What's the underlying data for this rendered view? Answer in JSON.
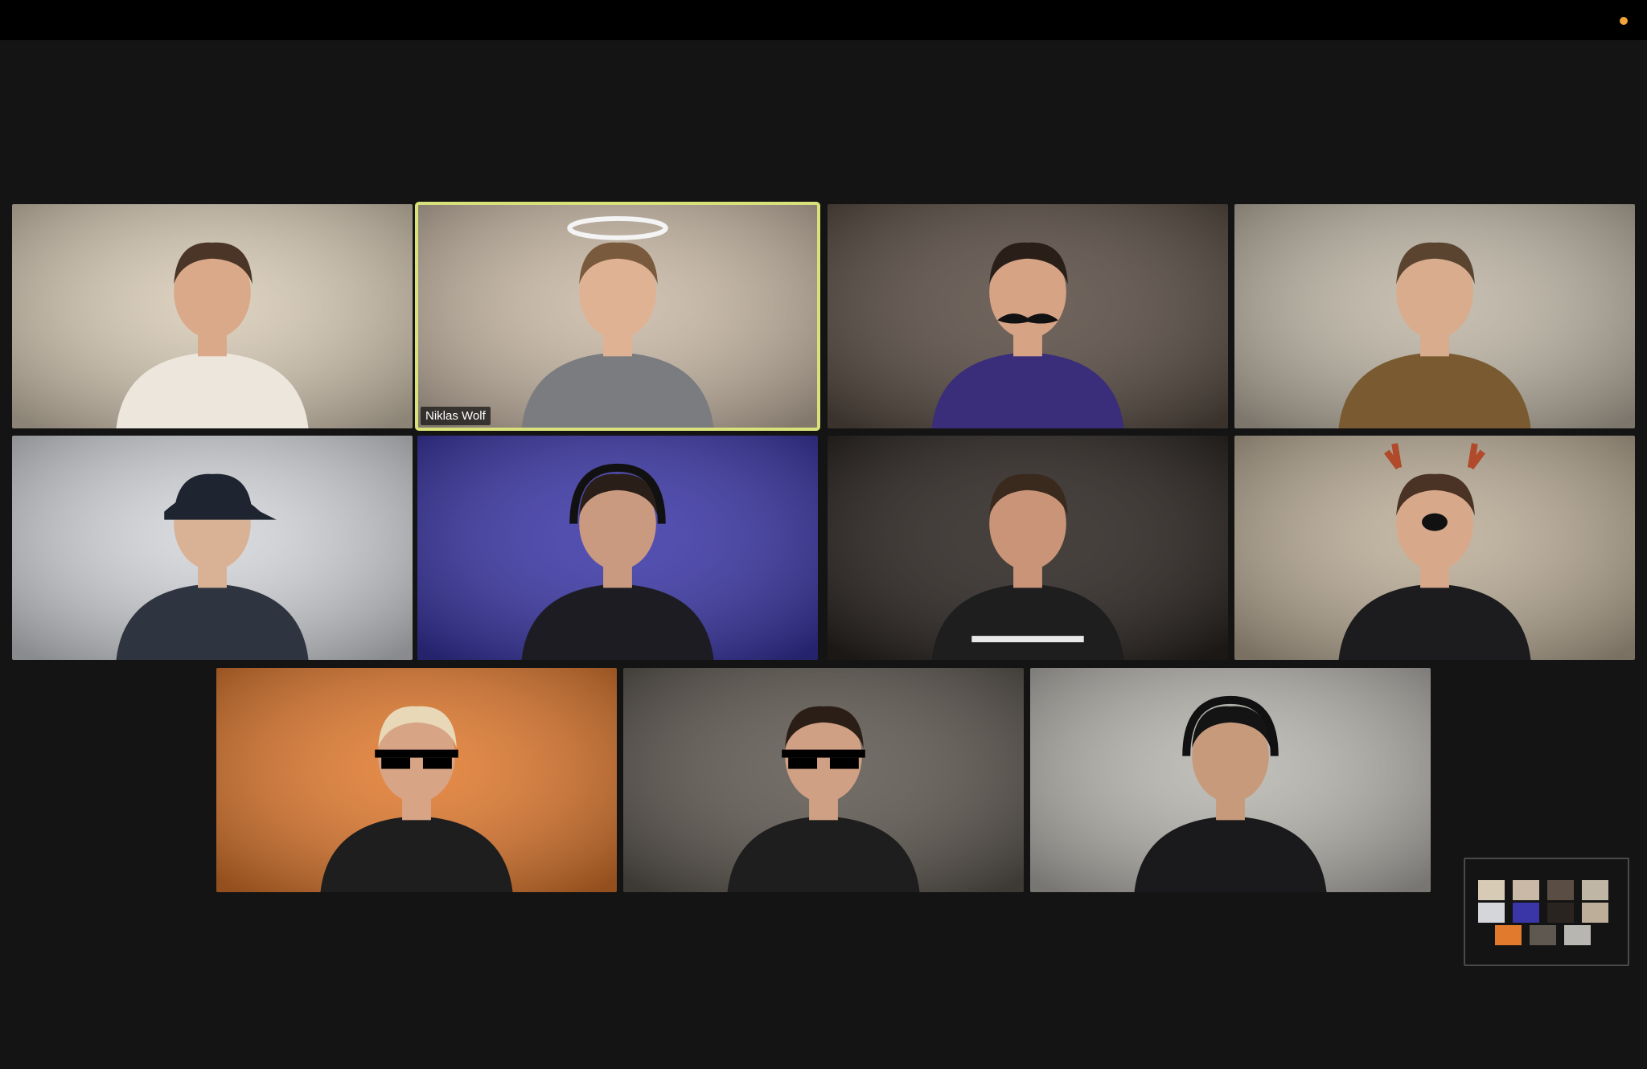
{
  "meeting": {
    "recording_indicator_color": "#f3a33b"
  },
  "participants": [
    {
      "label": "",
      "bg": "#d8cbb6",
      "skin": "#d9a98a",
      "shirt": "#ece6dc",
      "hair": "#4a3526",
      "accessory": "none"
    },
    {
      "label": "Niklas Wolf",
      "bg": "#c9b9a6",
      "skin": "#e0b294",
      "shirt": "#7a7c80",
      "hair": "#7a5a3c",
      "accessory": "halo",
      "active_speaker": true,
      "highlight_color": "#d9e27a"
    },
    {
      "label": "",
      "bg": "#5a4d44",
      "skin": "#d6a385",
      "shirt": "#3a2d7a",
      "hair": "#2a1e18",
      "accessory": "mustache"
    },
    {
      "label": "",
      "bg": "#bfb6a6",
      "skin": "#d8ac8c",
      "shirt": "#7a5a30",
      "hair": "#5a4430",
      "accessory": "none"
    },
    {
      "label": "",
      "bg": "#d4d6da",
      "skin": "#d9b295",
      "shirt": "#2e3440",
      "hair": "#1e2430",
      "accessory": "cap"
    },
    {
      "label": "",
      "bg": "#3a36a8",
      "skin": "#c99a80",
      "shirt": "#1c1c22",
      "hair": "#2a1e18",
      "accessory": "headset"
    },
    {
      "label": "",
      "bg": "#2a2420",
      "skin": "#c99478",
      "shirt": "#1e1e1e",
      "hair": "#3a2a1e",
      "accessory": "mothership"
    },
    {
      "label": "",
      "bg": "#bcae98",
      "skin": "#d8a88a",
      "shirt": "#1c1c1e",
      "hair": "#4a3224",
      "accessory": "reindeer"
    },
    {
      "label": "",
      "bg": "#e27a2e",
      "skin": "#d8a486",
      "shirt": "#1e1e1e",
      "hair": "#e8d8b8",
      "accessory": "deal-with-it-glasses"
    },
    {
      "label": "",
      "bg": "#5e5850",
      "skin": "#d0a084",
      "shirt": "#1e1e1e",
      "hair": "#2a1e16",
      "accessory": "deal-with-it-glasses"
    },
    {
      "label": "",
      "bg": "#b8b6b0",
      "skin": "#c89a7c",
      "shirt": "#1a1a1c",
      "hair": "#141414",
      "accessory": "headset"
    }
  ],
  "self_view": {
    "thumbnails": [
      "#d8cbb6",
      "#c9b9a6",
      "#5a4d44",
      "#bfb6a6",
      "#d4d6da",
      "#3a36a8",
      "#2a2420",
      "#bcae98",
      "#e27a2e",
      "#5e5850",
      "#b8b6b0"
    ]
  }
}
